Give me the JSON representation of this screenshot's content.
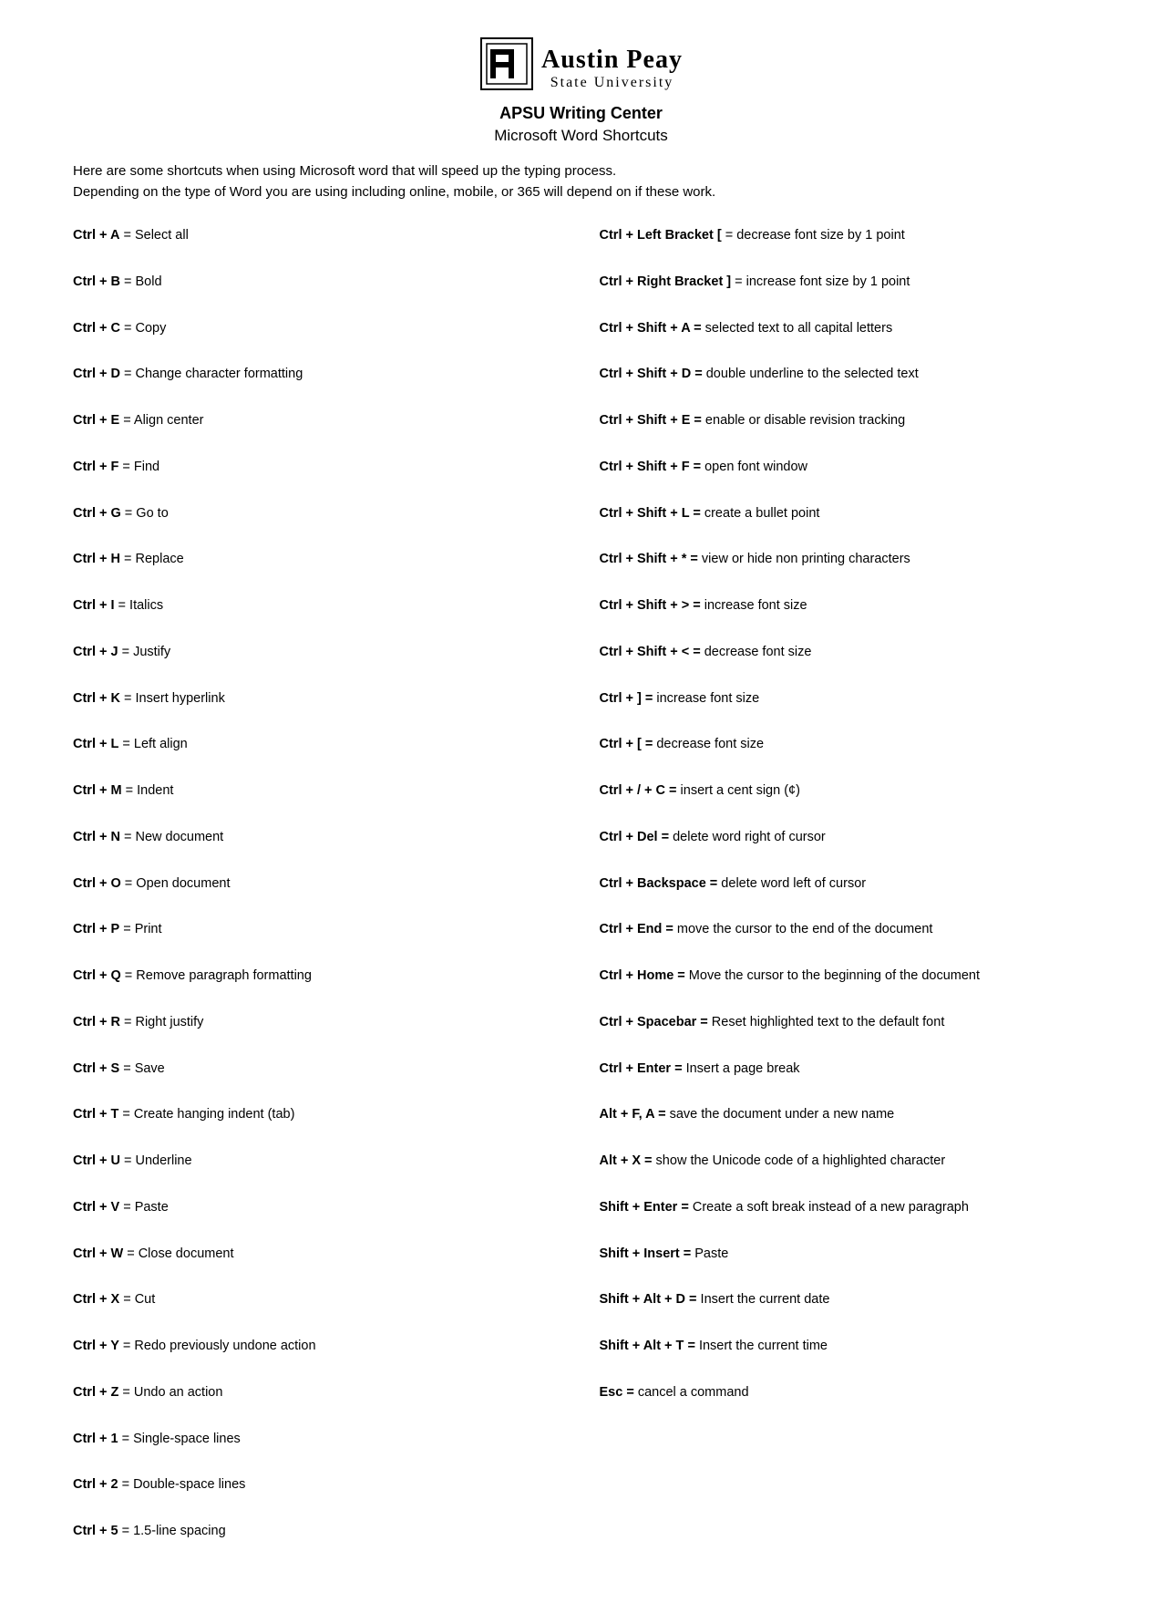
{
  "header": {
    "logo_text_main": "Austin Peay",
    "logo_text_sub": "State University",
    "center_title": "APSU Writing Center",
    "subtitle": "Microsoft Word Shortcuts"
  },
  "intro": {
    "line1": "Here are some shortcuts when using Microsoft word that will speed up the typing process.",
    "line2": "Depending on the type of Word you are using including online, mobile, or 365 will depend on if these work."
  },
  "shortcuts_left": [
    {
      "key": "Ctrl + A",
      "desc": " = Select all"
    },
    {
      "key": "Ctrl + B",
      "desc": " = Bold"
    },
    {
      "key": "Ctrl + C",
      "desc": " = Copy"
    },
    {
      "key": "Ctrl + D",
      "desc": " = Change character formatting"
    },
    {
      "key": "Ctrl + E",
      "desc": " = Align center"
    },
    {
      "key": "Ctrl + F",
      "desc": " = Find"
    },
    {
      "key": "Ctrl + G",
      "desc": " = Go to"
    },
    {
      "key": "Ctrl + H",
      "desc": " = Replace"
    },
    {
      "key": "Ctrl + I",
      "desc": " = Italics"
    },
    {
      "key": "Ctrl + J",
      "desc": " = Justify"
    },
    {
      "key": "Ctrl + K",
      "desc": " = Insert hyperlink"
    },
    {
      "key": "Ctrl + L",
      "desc": " = Left align"
    },
    {
      "key": "Ctrl + M",
      "desc": " = Indent"
    },
    {
      "key": "Ctrl + N",
      "desc": " = New document"
    },
    {
      "key": "Ctrl + O",
      "desc": " = Open document"
    },
    {
      "key": "Ctrl + P",
      "desc": " = Print"
    },
    {
      "key": "Ctrl + Q",
      "desc": " = Remove paragraph formatting"
    },
    {
      "key": "Ctrl + R",
      "desc": " = Right justify"
    },
    {
      "key": "Ctrl + S",
      "desc": " = Save"
    },
    {
      "key": "Ctrl + T",
      "desc": " = Create hanging indent (tab)"
    },
    {
      "key": "Ctrl + U",
      "desc": " = Underline"
    },
    {
      "key": "Ctrl + V",
      "desc": " = Paste"
    },
    {
      "key": "Ctrl + W",
      "desc": " = Close document"
    },
    {
      "key": "Ctrl + X",
      "desc": " = Cut"
    },
    {
      "key": "Ctrl + Y",
      "desc": " = Redo previously undone action"
    },
    {
      "key": "Ctrl + Z",
      "desc": " = Undo an action"
    },
    {
      "key": "Ctrl + 1",
      "desc": " = Single-space lines"
    },
    {
      "key": "Ctrl + 2",
      "desc": " = Double-space lines"
    },
    {
      "key": "Ctrl + 5",
      "desc": " = 1.5-line spacing"
    }
  ],
  "shortcuts_right": [
    {
      "key": "Ctrl + Left Bracket [",
      "desc": " = decrease font size by 1 point"
    },
    {
      "key": "Ctrl + Right Bracket ]",
      "desc": " = increase font size by 1 point"
    },
    {
      "key": "Ctrl + Shift + A =",
      "desc": "  selected text to all capital letters"
    },
    {
      "key": "Ctrl + Shift + D =",
      "desc": "  double underline to the selected text"
    },
    {
      "key": "Ctrl + Shift + E =",
      "desc": " enable or disable revision tracking"
    },
    {
      "key": "Ctrl + Shift + F =",
      "desc": " open font window"
    },
    {
      "key": "Ctrl + Shift + L =",
      "desc": " create a bullet point"
    },
    {
      "key": "Ctrl + Shift + * =",
      "desc": " view or hide non printing characters"
    },
    {
      "key": "Ctrl + Shift + > =",
      "desc": " increase font size"
    },
    {
      "key": "Ctrl + Shift + < =",
      "desc": " decrease font size"
    },
    {
      "key": "Ctrl + ] =",
      "desc": " increase font size"
    },
    {
      "key": "Ctrl + [ =",
      "desc": " decrease font size"
    },
    {
      "key": "Ctrl + / + C =",
      "desc": " insert a cent sign (¢)"
    },
    {
      "key": "Ctrl + Del =",
      "desc": " delete word right of cursor"
    },
    {
      "key": "Ctrl + Backspace =",
      "desc": " delete word left of cursor"
    },
    {
      "key": "Ctrl + End =",
      "desc": " move the cursor to the end of the document"
    },
    {
      "key": "Ctrl + Home =",
      "desc": " Move the cursor to the beginning of the document",
      "multiline": true
    },
    {
      "key": "Ctrl + Spacebar =",
      "desc": " Reset highlighted text to the default font"
    },
    {
      "key": "Ctrl + Enter =",
      "desc": " Insert a page break"
    },
    {
      "key": "Alt + F, A =",
      "desc": " save the document under a new name"
    },
    {
      "key": "Alt + X =",
      "desc": " show the Unicode code of a highlighted character"
    },
    {
      "key": "Shift + Enter =",
      "desc": " Create a soft break instead of a new paragraph",
      "multiline": true
    },
    {
      "key": "Shift + Insert =",
      "desc": " Paste"
    },
    {
      "key": "Shift + Alt + D =",
      "desc": " Insert the current date"
    },
    {
      "key": "Shift + Alt + T =",
      "desc": " Insert the current time"
    },
    {
      "key": "Esc =",
      "desc": " cancel a command"
    }
  ]
}
